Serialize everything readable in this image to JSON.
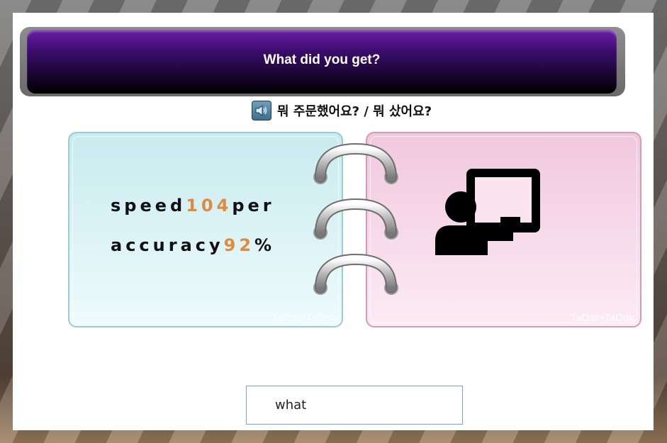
{
  "banner": {
    "title": "What did you get?"
  },
  "prompt": {
    "korean": "뭐 주문했어요? / 뭐 샀어요?",
    "speaker_icon": "speaker-icon"
  },
  "left_card": {
    "speed_label": "speed",
    "speed_value": "104",
    "speed_unit": "per",
    "accuracy_label": "accuracy",
    "accuracy_value": "92",
    "accuracy_unit": "%",
    "watermark": "TaDak•TaDak"
  },
  "right_card": {
    "image_icon": "teacher-at-board-icon",
    "watermark": "TaDak•TaDak"
  },
  "answer_input": {
    "value": "what"
  },
  "colors": {
    "banner_top": "#6b1ea8",
    "banner_bottom": "#000000",
    "left_card": "#c8ebef",
    "right_card": "#f1c8de",
    "number_accent": "#e08a3c"
  }
}
